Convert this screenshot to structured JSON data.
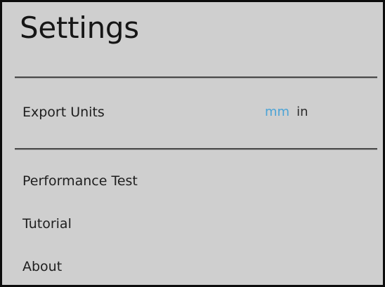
{
  "settings": {
    "title": "Settings",
    "export_units": {
      "label": "Export Units",
      "options": [
        "mm",
        "in"
      ],
      "selected": "mm",
      "selected_color": "#4ba3d6"
    },
    "menu": {
      "performance_test": "Performance Test",
      "tutorial": "Tutorial",
      "about": "About"
    }
  }
}
